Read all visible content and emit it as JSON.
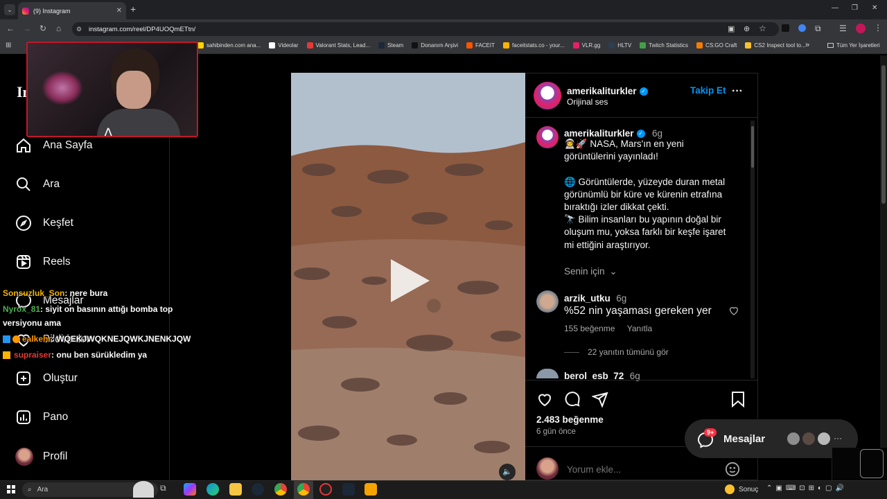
{
  "browser": {
    "tab_title": "(9) Instagram",
    "url": "instagram.com/reel/DP4UOQmETtn/",
    "bookmarks": [
      {
        "label": "sahibinden.com ana...",
        "color": "#ffd600"
      },
      {
        "label": "Videolar",
        "color": "#ffffff"
      },
      {
        "label": "Valorant Stats, Lead...",
        "color": "#e53935"
      },
      {
        "label": "Steam",
        "color": "#1b2838"
      },
      {
        "label": "Donanım Arşivi",
        "color": "#111111"
      },
      {
        "label": "FACEIT",
        "color": "#ff5500"
      },
      {
        "label": "faceitstats.co - your...",
        "color": "#ffb300"
      },
      {
        "label": "VLR.gg",
        "color": "#e91e63"
      },
      {
        "label": "HLTV",
        "color": "#2c3e50"
      },
      {
        "label": "Twitch Statistics",
        "color": "#43a047"
      },
      {
        "label": "CS:GO Craft",
        "color": "#f57c00"
      },
      {
        "label": "CS2 Inspect tool to...",
        "color": "#fbc02d"
      }
    ],
    "bookmarks_more": "»",
    "all_bookmarks": "Tüm Yer İşaretleri"
  },
  "sidebar": {
    "items": [
      {
        "label": "Ana Sayfa",
        "icon": "home-icon"
      },
      {
        "label": "Ara",
        "icon": "search-icon"
      },
      {
        "label": "Keşfet",
        "icon": "compass-icon"
      },
      {
        "label": "Reels",
        "icon": "reels-icon"
      },
      {
        "label": "Mesajlar",
        "icon": "messenger-icon"
      },
      {
        "label": "Bildirimler",
        "icon": "heart-icon"
      },
      {
        "label": "Oluştur",
        "icon": "plus-icon"
      },
      {
        "label": "Pano",
        "icon": "dashboard-icon"
      },
      {
        "label": "Profil",
        "icon": "avatar"
      }
    ]
  },
  "chat_overlay": [
    {
      "user": "Sonsuzluk_Son",
      "color": "#f4b400",
      "text": ": nere bura"
    },
    {
      "user": "Nyrox_81",
      "color": "#4caf50",
      "text": ": siyit on basının attığı bomba top"
    },
    {
      "user": "",
      "color": "#ffffff",
      "text": "versiyonu ama"
    },
    {
      "user": "ealkehr",
      "color": "#ff9800",
      "text": ": WQEKJWQKNEJQWKJNENKJQW"
    },
    {
      "user": "supraiser",
      "color": "#e53935",
      "text": ": onu ben sürükledim ya"
    }
  ],
  "post": {
    "author": "amerikaliturkler",
    "audio": "Orijinal ses",
    "follow_label": "Takip Et",
    "caption_author": "amerikaliturkler",
    "caption_age": "6g",
    "caption": "👨‍🚀🚀 NASA, Mars'ın en yeni görüntülerini yayınladı!\n\n🌐 Görüntülerde, yüzeyde duran metal görünümlü bir küre ve kürenin etrafına bıraktığı izler dikkat çekti.\n🔭 Bilim insanları bu yapının doğal bir oluşum mu, yoksa farklı bir keşfe işaret mi ettiğini araştırıyor.",
    "for_you_label": "Senin için",
    "comments": [
      {
        "user": "arzik_utku",
        "age": "6g",
        "text": "%52 nin yaşaması gereken yer",
        "likes": "155 beğenme",
        "reply_label": "Yanıtla",
        "view_replies": "22 yanıtın tümünü gör"
      },
      {
        "user": "berol_esb_72",
        "age": "6g"
      }
    ],
    "like_count": "2.483 beğenme",
    "date": "6 gün önce",
    "comment_placeholder": "Yorum ekle..."
  },
  "messages_pill": {
    "label": "Mesajlar",
    "badge": "9+"
  },
  "taskbar": {
    "search_placeholder": "Ara",
    "weather": "Sonuç"
  }
}
